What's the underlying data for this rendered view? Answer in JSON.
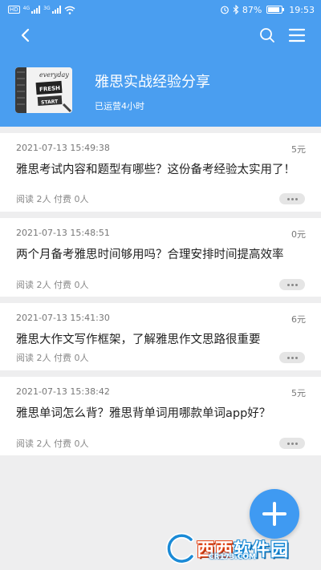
{
  "status_bar": {
    "carrier_badge": "HD",
    "net1": "4G",
    "net2": "3G",
    "battery_percent": "87%",
    "battery_level": 0.87,
    "time": "19:53"
  },
  "icons": {
    "back": "back-arrow-icon",
    "search": "search-icon",
    "menu": "menu-icon"
  },
  "group": {
    "title": "雅思实战经验分享",
    "subtitle": "已运营4小时",
    "cover_text": [
      "everyday",
      "FRESH",
      "START"
    ]
  },
  "posts": [
    {
      "date": "2021-07-13 15:49:38",
      "price": "5元",
      "title": "雅思考试内容和题型有哪些？这份备考经验太实用了！",
      "meta": "阅读 2人 付费 0人"
    },
    {
      "date": "2021-07-13 15:48:51",
      "price": "0元",
      "title": "两个月备考雅思时间够用吗？合理安排时间提高效率",
      "meta": "阅读 2人 付费 0人"
    },
    {
      "date": "2021-07-13 15:41:30",
      "price": "6元",
      "title": "雅思大作文写作框架，了解雅思作文思路很重要",
      "meta": "阅读 2人 付费 0人"
    },
    {
      "date": "2021-07-13 15:38:42",
      "price": "5元",
      "title": "雅思单词怎么背？雅思背单词用哪款单词app好？",
      "meta": "阅读 2人 付费 0人"
    }
  ],
  "watermark": {
    "brand_a": "西西",
    "brand_b": "软件园",
    "url": "CR173.COM"
  },
  "colors": {
    "header_bg": "#4a9ef0",
    "fab_bg": "#3f9af2",
    "page_bg": "#eeeeef"
  }
}
